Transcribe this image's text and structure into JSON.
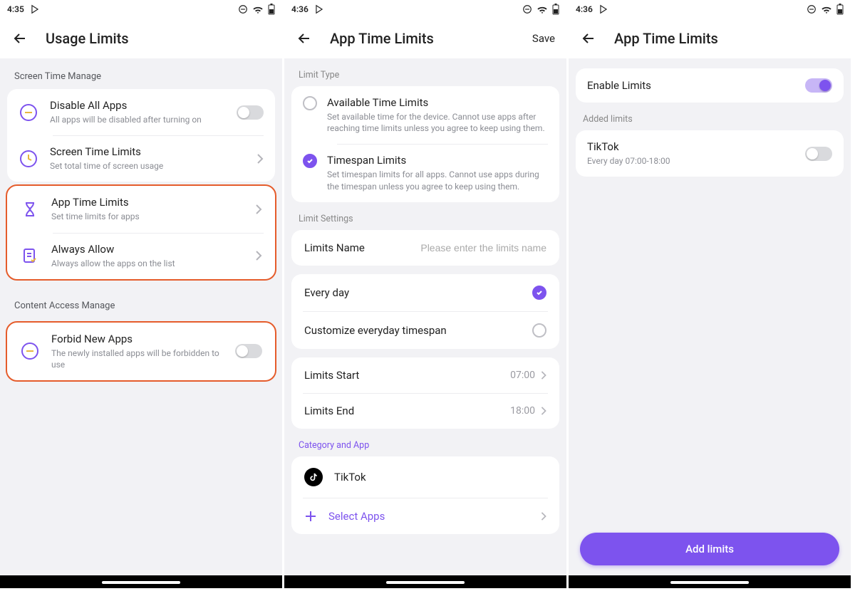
{
  "colors": {
    "accent": "#7d53ee",
    "highlight": "#e55c2b"
  },
  "screen1": {
    "time": "4:35",
    "title": "Usage Limits",
    "section_stm": "Screen Time Manage",
    "disable_all": {
      "title": "Disable All Apps",
      "sub": "All apps will be disabled after turning on",
      "on": false
    },
    "stl": {
      "title": "Screen Time Limits",
      "sub": "Set total time of screen usage"
    },
    "atl": {
      "title": "App Time Limits",
      "sub": "Set time limits for apps"
    },
    "allow": {
      "title": "Always Allow",
      "sub": "Always allow the apps on the list"
    },
    "section_cam": "Content Access Manage",
    "forbid": {
      "title": "Forbid New Apps",
      "sub": "The newly installed apps will be forbidden to use",
      "on": false
    }
  },
  "screen2": {
    "time": "4:36",
    "title": "App Time Limits",
    "save": "Save",
    "limit_type_label": "Limit Type",
    "avail": {
      "title": "Available Time Limits",
      "sub": "Set available time for the device. Cannot use apps after reaching time limits unless you agree to keep using them."
    },
    "timespan": {
      "title": "Timespan Limits",
      "sub": "Set timespan limits for all apps. Cannot use apps during the timespan unless you agree to keep using them."
    },
    "limit_settings_label": "Limit Settings",
    "name_label": "Limits Name",
    "name_placeholder": "Please enter the limits name",
    "everyday": "Every day",
    "customize": "Customize everyday timespan",
    "start_label": "Limits Start",
    "start_val": "07:00",
    "end_label": "Limits End",
    "end_val": "18:00",
    "cat_label": "Category and App",
    "app_tiktok": "TikTok",
    "select_apps": "Select Apps"
  },
  "screen3": {
    "time": "4:36",
    "title": "App Time Limits",
    "enable_label": "Enable Limits",
    "enable_on": true,
    "added_label": "Added limits",
    "item": {
      "title": "TikTok",
      "sub": "Every day 07:00-18:00",
      "on": false
    },
    "add_button": "Add limits"
  }
}
